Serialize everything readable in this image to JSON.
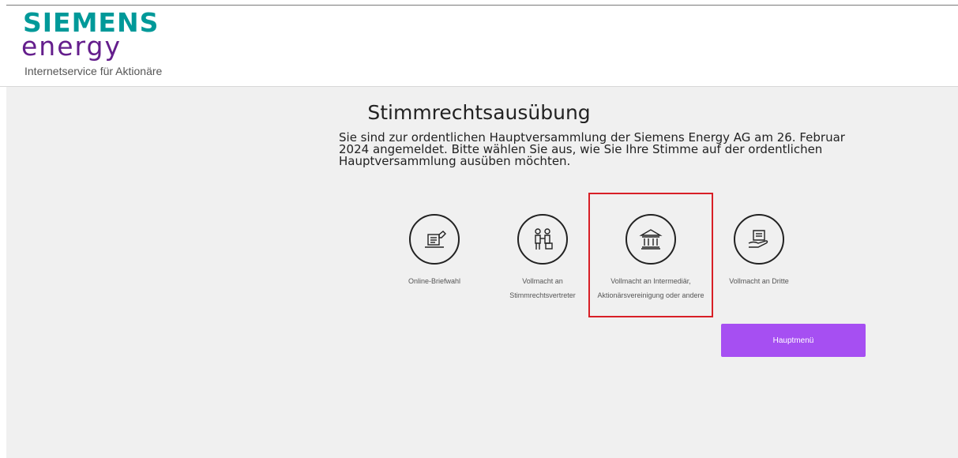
{
  "header": {
    "logo_line1": "SIEMENS",
    "logo_line2": "energy",
    "tagline": "Internetservice für Aktionäre"
  },
  "page": {
    "title": "Stimmrechtsausübung",
    "intro": "Sie sind zur ordentlichen Hauptversammlung der Siemens Energy AG am 26. Februar 2024 angemeldet. Bitte wählen Sie aus, wie Sie Ihre Stimme auf der ordentlichen Hauptversammlung ausüben möchten."
  },
  "options": [
    {
      "label": "Online-Briefwahl",
      "icon": "ballot-box-icon"
    },
    {
      "label": "Vollmacht an Stimmrechtsvertreter",
      "icon": "proxy-handshake-icon"
    },
    {
      "label": "Vollmacht an Intermediär, Aktionärsvereinigung oder andere",
      "icon": "bank-building-icon",
      "selected": true
    },
    {
      "label": "Vollmacht an Dritte",
      "icon": "hand-document-icon"
    }
  ],
  "buttons": {
    "main_menu": "Hauptmenü"
  },
  "colors": {
    "accent": "#a64ff2",
    "highlight": "#d81f26",
    "logo_teal": "#009999",
    "logo_purple": "#641e8c"
  }
}
